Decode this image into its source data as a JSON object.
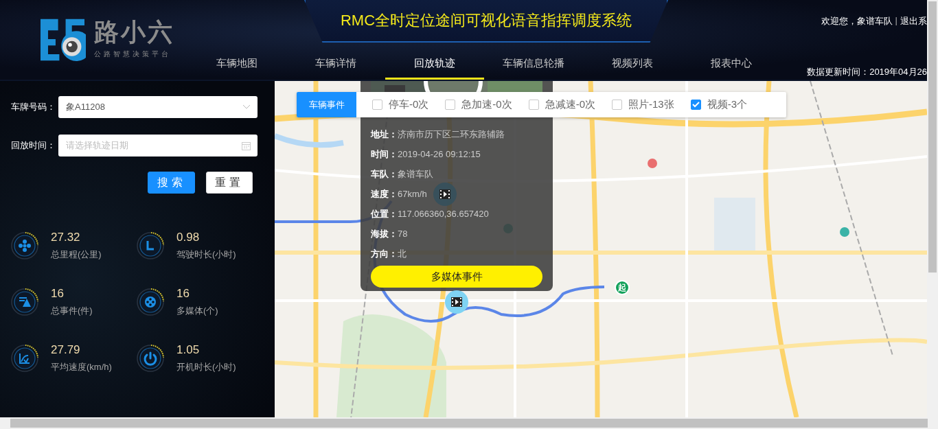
{
  "header": {
    "logo": {
      "name": "路小六",
      "slogan": "公路智慧决策平台"
    },
    "title": "RMC全时定位途间可视化语音指挥调度系统",
    "welcome": "欢迎您，象谱车队",
    "separator": "|",
    "logout": "退出系",
    "update_time": "数据更新时间：2019年04月26"
  },
  "nav": [
    {
      "label": "车辆地图",
      "selected": false
    },
    {
      "label": "车辆详情",
      "selected": false
    },
    {
      "label": "回放轨迹",
      "selected": true
    },
    {
      "label": "车辆信息轮播",
      "selected": false
    },
    {
      "label": "视频列表",
      "selected": false
    },
    {
      "label": "报表中心",
      "selected": false
    }
  ],
  "sidebar": {
    "fields": [
      {
        "kind": "select",
        "label": "车牌号码：",
        "value": "象A11208"
      },
      {
        "kind": "date",
        "label": "回放时间：",
        "placeholder": "请选择轨迹日期"
      }
    ],
    "buttons": [
      {
        "kind": "primary",
        "label": "搜索"
      },
      {
        "kind": "default",
        "label": "重置"
      }
    ],
    "stats": [
      {
        "kind": "distance",
        "value": "27.32",
        "label": "总里程(公里)"
      },
      {
        "kind": "duration",
        "value": "0.98",
        "label": "驾驶时长(小时)"
      },
      {
        "kind": "events",
        "value": "16",
        "label": "总事件(件)"
      },
      {
        "kind": "media",
        "value": "16",
        "label": "多媒体(个)"
      },
      {
        "kind": "speed",
        "value": "27.79",
        "label": "平均速度(km/h)"
      },
      {
        "kind": "power",
        "value": "1.05",
        "label": "开机时长(小时)"
      }
    ]
  },
  "map": {
    "kind": "picture",
    "event_bar": {
      "title": "车辆事件",
      "filters": [
        {
          "label": "停车-0次",
          "checked": false
        },
        {
          "label": "急加速-0次",
          "checked": false
        },
        {
          "label": "急减速-0次",
          "checked": false
        },
        {
          "label": "照片-13张",
          "checked": false
        },
        {
          "label": "视频-3个",
          "checked": true
        }
      ]
    },
    "popup": {
      "fields": [
        {
          "label": "地址：",
          "value": "济南市历下区二环东路辅路"
        },
        {
          "label": "时间：",
          "value": "2019-04-26 09:12:15"
        },
        {
          "label": "车队：",
          "value": "象谱车队"
        },
        {
          "label": "速度：",
          "value": "67km/h"
        },
        {
          "label": "位置：",
          "value": "117.066360,36.657420"
        },
        {
          "label": "海拔：",
          "value": "78"
        },
        {
          "label": "方向：",
          "value": "北"
        }
      ],
      "button": "多媒体事件"
    },
    "start_marker": "起"
  }
}
